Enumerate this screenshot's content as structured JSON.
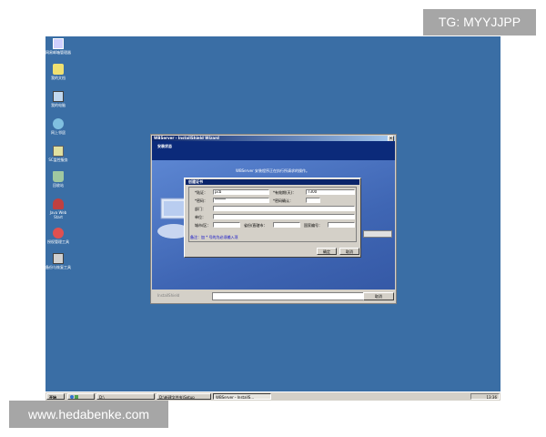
{
  "watermarks": {
    "top": "TG: MYYJJPP",
    "bottom": "www.hedabenke.com"
  },
  "desktop": {
    "icons": [
      {
        "name": "desktop-icon-1",
        "label": "网易邮箱管理器",
        "color": "#d0d0ff"
      },
      {
        "name": "desktop-icon-2",
        "label": "我的文档",
        "color": "#f0e070"
      },
      {
        "name": "desktop-icon-3",
        "label": "我的电脑",
        "color": "#c0d8f0"
      },
      {
        "name": "desktop-icon-4",
        "label": "网上邻居",
        "color": "#80c0e0"
      },
      {
        "name": "desktop-icon-5",
        "label": "SC监控服务",
        "color": "#e0e0a0"
      },
      {
        "name": "desktop-icon-6",
        "label": "回收站",
        "color": "#a0c8a0"
      },
      {
        "name": "desktop-icon-7",
        "label": "Java Web Start",
        "color": "#c04040"
      },
      {
        "name": "desktop-icon-8",
        "label": "授权管理工具",
        "color": "#e05050"
      },
      {
        "name": "desktop-icon-9",
        "label": "备份与恢复工具",
        "color": "#d0d0d0"
      }
    ]
  },
  "installer": {
    "title": "WBServer - InstallShield Wizard",
    "header_title": "安装状态",
    "message": "WBServer 安装程序正在执行所请求的操作。",
    "footer_label": "InstallShield",
    "cancel_label": "取消"
  },
  "dialog": {
    "title": "创建证书",
    "fields": {
      "label_cn": "*陆证：",
      "value_cn": "pcb",
      "label_validity": "*有效期(天)：",
      "value_validity": "7300",
      "label_password": "*密码：",
      "value_password": "******",
      "label_password_confirm": "*密码确认：",
      "value_password_confirm": "",
      "label_dept": "部门：",
      "value_dept": "",
      "label_unit": "单位：",
      "value_unit": "",
      "label_city": "城市/区：",
      "value_city": "",
      "label_province": "省份/直辖市：",
      "value_province": "",
      "label_country": "国家编号：",
      "value_country": ""
    },
    "note": "备注：加 * 号的为必须输入项",
    "ok_label": "确定",
    "cancel_label": "取消"
  },
  "taskbar": {
    "start_label": "开始",
    "buttons": [
      {
        "label": "D:\\"
      },
      {
        "label": "D:\\新建文件夹\\Setup"
      },
      {
        "label": "WBServer - InstallS..."
      }
    ],
    "clock": "13:36"
  }
}
